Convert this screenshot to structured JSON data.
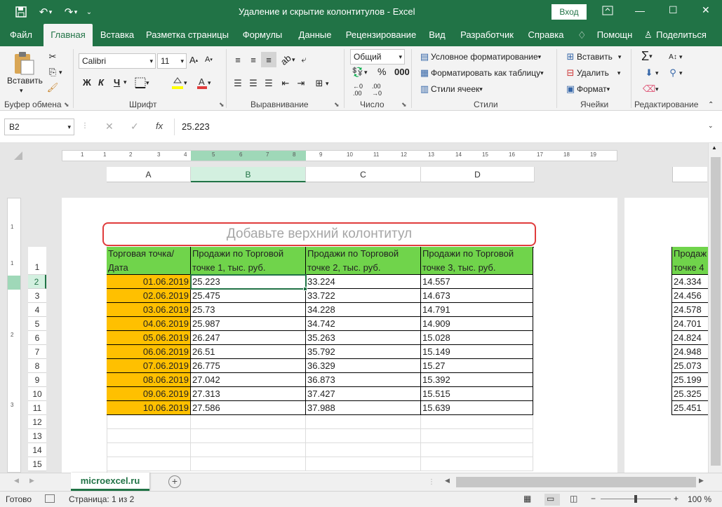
{
  "titlebar": {
    "title": "Удаление и скрытие колонтитулов  -  Excel",
    "signin": "Вход",
    "minimize": "—",
    "restore": "☐",
    "close": "✕"
  },
  "tabs": [
    "Файл",
    "Главная",
    "Вставка",
    "Разметка страницы",
    "Формулы",
    "Данные",
    "Рецензирование",
    "Вид",
    "Разработчик",
    "Справка",
    "Помощн",
    "Поделиться"
  ],
  "ribbon": {
    "paste": "Вставить",
    "clipboard": "Буфер обмена",
    "font_name": "Calibri",
    "font_size": "11",
    "font_group": "Шрифт",
    "bold": "Ж",
    "italic": "К",
    "underline": "Ч",
    "align_group": "Выравнивание",
    "number_format": "Общий",
    "number_group": "Число",
    "cond_format": "Условное форматирование",
    "format_table": "Форматировать как таблицу",
    "cell_styles": "Стили ячеек",
    "styles_group": "Стили",
    "insert": "Вставить",
    "delete": "Удалить",
    "format": "Формат",
    "cells_group": "Ячейки",
    "editing_group": "Редактирование"
  },
  "formula_bar": {
    "name_box": "B2",
    "fx": "fx",
    "value": "25.223"
  },
  "columns": [
    "A",
    "B",
    "C",
    "D"
  ],
  "header_placeholder": "Добавьте верхний колонтитул",
  "table_headers": [
    "Торговая точка/ Дата",
    "Продажи по Торговой точке 1, тыс. руб.",
    "Продажи по Торговой точке 2, тыс. руб.",
    "Продажи по Торговой точке 3, тыс. руб."
  ],
  "header_lines": [
    [
      "Торговая точка/",
      "Дата"
    ],
    [
      "Продажи по Торговой",
      "точке 1, тыс. руб."
    ],
    [
      "Продажи по Торговой",
      "точке 2, тыс. руб."
    ],
    [
      "Продажи по Торговой",
      "точке 3, тыс. руб."
    ]
  ],
  "rows": [
    [
      "01.06.2019",
      "25.223",
      "33.224",
      "14.557"
    ],
    [
      "02.06.2019",
      "25.475",
      "33.722",
      "14.673"
    ],
    [
      "03.06.2019",
      "25.73",
      "34.228",
      "14.791"
    ],
    [
      "04.06.2019",
      "25.987",
      "34.742",
      "14.909"
    ],
    [
      "05.06.2019",
      "26.247",
      "35.263",
      "15.028"
    ],
    [
      "06.06.2019",
      "26.51",
      "35.792",
      "15.149"
    ],
    [
      "07.06.2019",
      "26.775",
      "36.329",
      "15.27"
    ],
    [
      "08.06.2019",
      "27.042",
      "36.873",
      "15.392"
    ],
    [
      "09.06.2019",
      "27.313",
      "37.427",
      "15.515"
    ],
    [
      "10.06.2019",
      "27.586",
      "37.988",
      "15.639"
    ]
  ],
  "page2": {
    "header_lines": [
      "Продаж",
      "точке 4"
    ],
    "values": [
      "24.334",
      "24.456",
      "24.578",
      "24.701",
      "24.824",
      "24.948",
      "25.073",
      "25.199",
      "25.325",
      "25.451"
    ]
  },
  "row_numbers": [
    "1",
    "2",
    "3",
    "4",
    "5",
    "6",
    "7",
    "8",
    "9",
    "10",
    "11",
    "12",
    "13",
    "14",
    "15"
  ],
  "ruler_numbers": [
    "1",
    "1",
    "2",
    "3",
    "4",
    "5",
    "6",
    "7",
    "8",
    "9",
    "10",
    "11",
    "12",
    "13",
    "14",
    "15",
    "16",
    "17",
    "18",
    "19"
  ],
  "sheet_tab": "microexcel.ru",
  "status": {
    "ready": "Готово",
    "page": "Страница: 1 из 2",
    "zoom": "100 %"
  },
  "colors": {
    "brand": "#217346",
    "header_fill": "#70d44b",
    "date_fill": "#ffc000",
    "highlight": "#e03c3c"
  }
}
